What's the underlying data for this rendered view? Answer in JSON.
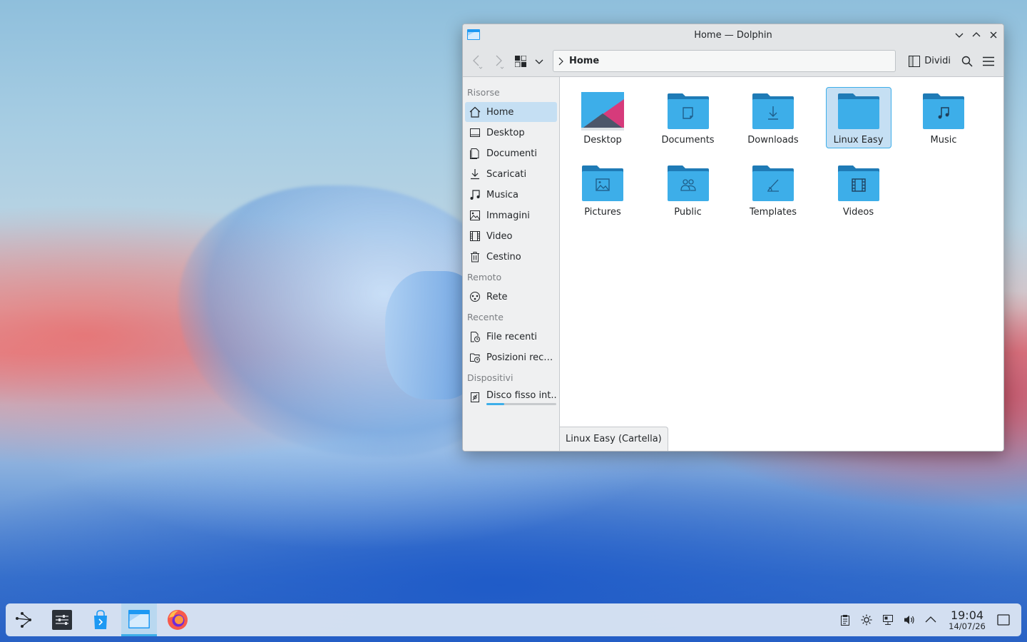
{
  "window": {
    "title": "Home — Dolphin"
  },
  "toolbar": {
    "breadcrumb": [
      "Home"
    ],
    "split_label": "Dividi"
  },
  "sidebar": {
    "sections": [
      {
        "label": "Risorse",
        "items": [
          {
            "label": "Home",
            "icon": "home-icon",
            "active": true
          },
          {
            "label": "Desktop",
            "icon": "desktop-icon"
          },
          {
            "label": "Documenti",
            "icon": "document-icon"
          },
          {
            "label": "Scaricati",
            "icon": "download-icon"
          },
          {
            "label": "Musica",
            "icon": "music-icon"
          },
          {
            "label": "Immagini",
            "icon": "image-icon"
          },
          {
            "label": "Video",
            "icon": "video-icon"
          },
          {
            "label": "Cestino",
            "icon": "trash-icon"
          }
        ]
      },
      {
        "label": "Remoto",
        "items": [
          {
            "label": "Rete",
            "icon": "network-icon"
          }
        ]
      },
      {
        "label": "Recente",
        "items": [
          {
            "label": "File recenti",
            "icon": "recent-files-icon"
          },
          {
            "label": "Posizioni rece...",
            "icon": "recent-locations-icon"
          }
        ]
      },
      {
        "label": "Dispositivi",
        "items": [
          {
            "label": "Disco fisso int...",
            "icon": "hard-disk-icon",
            "usage_fraction": 0.25
          }
        ]
      }
    ]
  },
  "files": [
    {
      "name": "Desktop",
      "icon": "desktop-folder-icon"
    },
    {
      "name": "Documents",
      "icon": "documents-folder-icon"
    },
    {
      "name": "Downloads",
      "icon": "downloads-folder-icon"
    },
    {
      "name": "Linux Easy",
      "icon": "folder-icon",
      "selected": true
    },
    {
      "name": "Music",
      "icon": "music-folder-icon"
    },
    {
      "name": "Pictures",
      "icon": "pictures-folder-icon"
    },
    {
      "name": "Public",
      "icon": "public-folder-icon"
    },
    {
      "name": "Templates",
      "icon": "templates-folder-icon"
    },
    {
      "name": "Videos",
      "icon": "videos-folder-icon"
    }
  ],
  "status": {
    "text": "Linux Easy (Cartella)"
  },
  "taskbar": {
    "items": [
      {
        "icon": "app-launcher-icon"
      },
      {
        "icon": "system-settings-icon"
      },
      {
        "icon": "discover-store-icon"
      },
      {
        "icon": "dolphin-icon",
        "active": true
      },
      {
        "icon": "firefox-icon"
      }
    ],
    "tray": [
      "clipboard-icon",
      "brightness-icon",
      "network-wired-icon",
      "volume-icon",
      "expand-tray-icon"
    ],
    "clock": {
      "time": "19:04",
      "date": "14/07/26"
    }
  },
  "colors": {
    "accent": "#3daee9",
    "folder": "#3daee9",
    "selection": "#c5dff3"
  }
}
